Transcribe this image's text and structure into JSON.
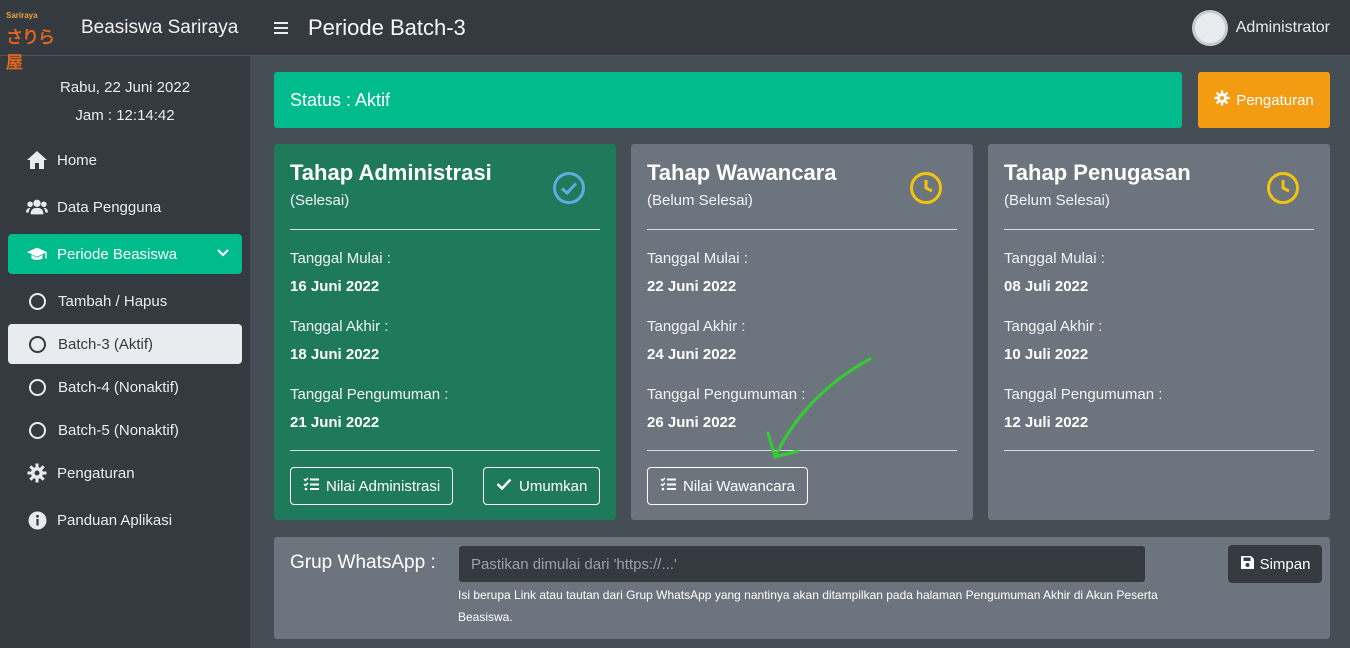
{
  "brand": {
    "logo_small": "Sariraya",
    "logo_main": "さりら屋",
    "title": "Beasiswa Sariraya"
  },
  "header": {
    "page_title": "Periode Batch-3",
    "user_name": "Administrator"
  },
  "sidebar": {
    "date": "Rabu, 22 Juni 2022",
    "time": "Jam : 12:14:42",
    "items": [
      {
        "label": "Home",
        "icon": "home-icon"
      },
      {
        "label": "Data Pengguna",
        "icon": "users-icon"
      },
      {
        "label": "Periode Beasiswa",
        "icon": "graduation-cap-icon"
      },
      {
        "label": "Pengaturan",
        "icon": "gear-icon"
      },
      {
        "label": "Panduan Aplikasi",
        "icon": "info-icon"
      }
    ],
    "subitems": [
      {
        "label": "Tambah / Hapus"
      },
      {
        "label": "Batch-3 (Aktif)"
      },
      {
        "label": "Batch-4 (Nonaktif)"
      },
      {
        "label": "Batch-5 (Nonaktif)"
      }
    ]
  },
  "status": {
    "label": "Status : Aktif",
    "settings_button": "Pengaturan"
  },
  "cards": [
    {
      "title": "Tahap Administrasi",
      "subtitle": "(Selesai)",
      "start_label": "Tanggal Mulai :",
      "start_value": "16 Juni 2022",
      "end_label": "Tanggal Akhir :",
      "end_value": "18 Juni 2022",
      "announce_label": "Tanggal Pengumuman :",
      "announce_value": "21 Juni 2022",
      "button1": "Nilai Administrasi",
      "button2": "Umumkan",
      "icon": "check-circle-icon"
    },
    {
      "title": "Tahap Wawancara",
      "subtitle": "(Belum Selesai)",
      "start_label": "Tanggal Mulai :",
      "start_value": "22 Juni 2022",
      "end_label": "Tanggal Akhir :",
      "end_value": "24 Juni 2022",
      "announce_label": "Tanggal Pengumuman :",
      "announce_value": "26 Juni 2022",
      "button1": "Nilai Wawancara",
      "icon": "clock-icon"
    },
    {
      "title": "Tahap Penugasan",
      "subtitle": "(Belum Selesai)",
      "start_label": "Tanggal Mulai :",
      "start_value": "08 Juli 2022",
      "end_label": "Tanggal Akhir :",
      "end_value": "10 Juli 2022",
      "announce_label": "Tanggal Pengumuman :",
      "announce_value": "12 Juli 2022",
      "icon": "clock-icon"
    }
  ],
  "whatsapp": {
    "label": "Grup WhatsApp :",
    "placeholder": "Pastikan dimulai dari 'https://...'",
    "help": "Isi berupa Link atau tautan dari Grup WhatsApp yang nantinya akan ditampilkan pada halaman Pengumuman Akhir di Akun Peserta Beasiswa.",
    "save_button": "Simpan"
  },
  "colors": {
    "accent": "#00bc8c",
    "warning": "#f39c12",
    "check": "#5dade2",
    "clock": "#f1c40f",
    "arrow": "#33cc33"
  }
}
